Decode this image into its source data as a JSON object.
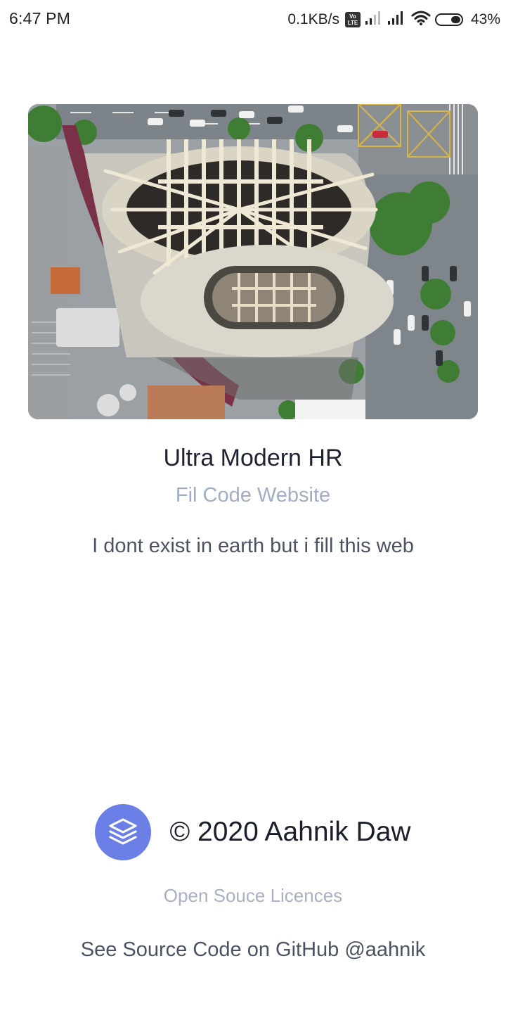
{
  "status_bar": {
    "time": "6:47 PM",
    "net_speed": "0.1KB/s",
    "volte_top": "Vo",
    "volte_bottom": "LTE",
    "battery_percent": "43%",
    "battery_level": 0.43
  },
  "hero": {
    "image_icon": "aerial-building-photo"
  },
  "app": {
    "title": "Ultra Modern HR",
    "subtitle": "Fil Code Website",
    "description": "I dont exist in earth but i fill this web"
  },
  "footer": {
    "logo_icon": "layers-icon",
    "copyright": "© 2020 Aahnik Daw",
    "licences_label": "Open Souce Licences",
    "github_label": "See Source Code on GitHub @aahnik"
  },
  "colors": {
    "accent": "#6b7fe6",
    "muted_text": "#a1adc4",
    "body_text": "#4a5263",
    "heading_text": "#1f2330"
  }
}
